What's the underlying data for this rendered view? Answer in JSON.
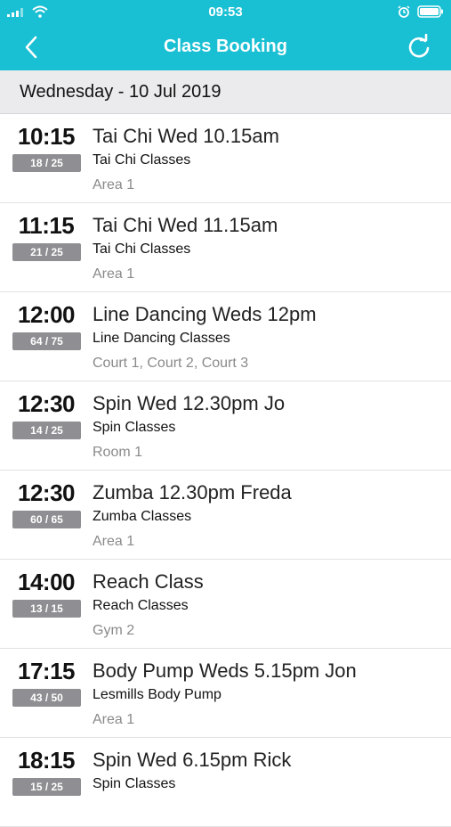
{
  "status_bar": {
    "time": "09:53",
    "icons": [
      "signal-icon",
      "wifi-icon",
      "alarm-icon",
      "battery-icon"
    ]
  },
  "nav": {
    "title": "Class Booking",
    "back_icon": "chevron-left-icon",
    "refresh_icon": "refresh-icon"
  },
  "date_header": "Wednesday - 10 Jul 2019",
  "colors": {
    "accent": "#19bfd3",
    "capacity_badge": "#8e8e93",
    "section_bg": "#ebebed"
  },
  "classes": [
    {
      "time": "10:15",
      "capacity": "18 / 25",
      "name": "Tai Chi Wed 10.15am",
      "category": "Tai Chi Classes",
      "location": "Area 1"
    },
    {
      "time": "11:15",
      "capacity": "21 / 25",
      "name": "Tai Chi Wed 11.15am",
      "category": "Tai Chi Classes",
      "location": "Area 1"
    },
    {
      "time": "12:00",
      "capacity": "64 / 75",
      "name": "Line Dancing Weds 12pm",
      "category": "Line Dancing Classes",
      "location": "Court 1, Court 2, Court 3"
    },
    {
      "time": "12:30",
      "capacity": "14 / 25",
      "name": "Spin Wed 12.30pm Jo",
      "category": "Spin Classes",
      "location": "Room 1"
    },
    {
      "time": "12:30",
      "capacity": "60 / 65",
      "name": "Zumba 12.30pm Freda",
      "category": "Zumba Classes",
      "location": "Area 1"
    },
    {
      "time": "14:00",
      "capacity": "13 / 15",
      "name": "Reach Class",
      "category": "Reach Classes",
      "location": "Gym 2"
    },
    {
      "time": "17:15",
      "capacity": "43 / 50",
      "name": "Body Pump Weds 5.15pm Jon",
      "category": "Lesmills Body Pump",
      "location": "Area 1"
    },
    {
      "time": "18:15",
      "capacity": "15 / 25",
      "name": "Spin Wed 6.15pm Rick",
      "category": "Spin Classes",
      "location": ""
    }
  ]
}
